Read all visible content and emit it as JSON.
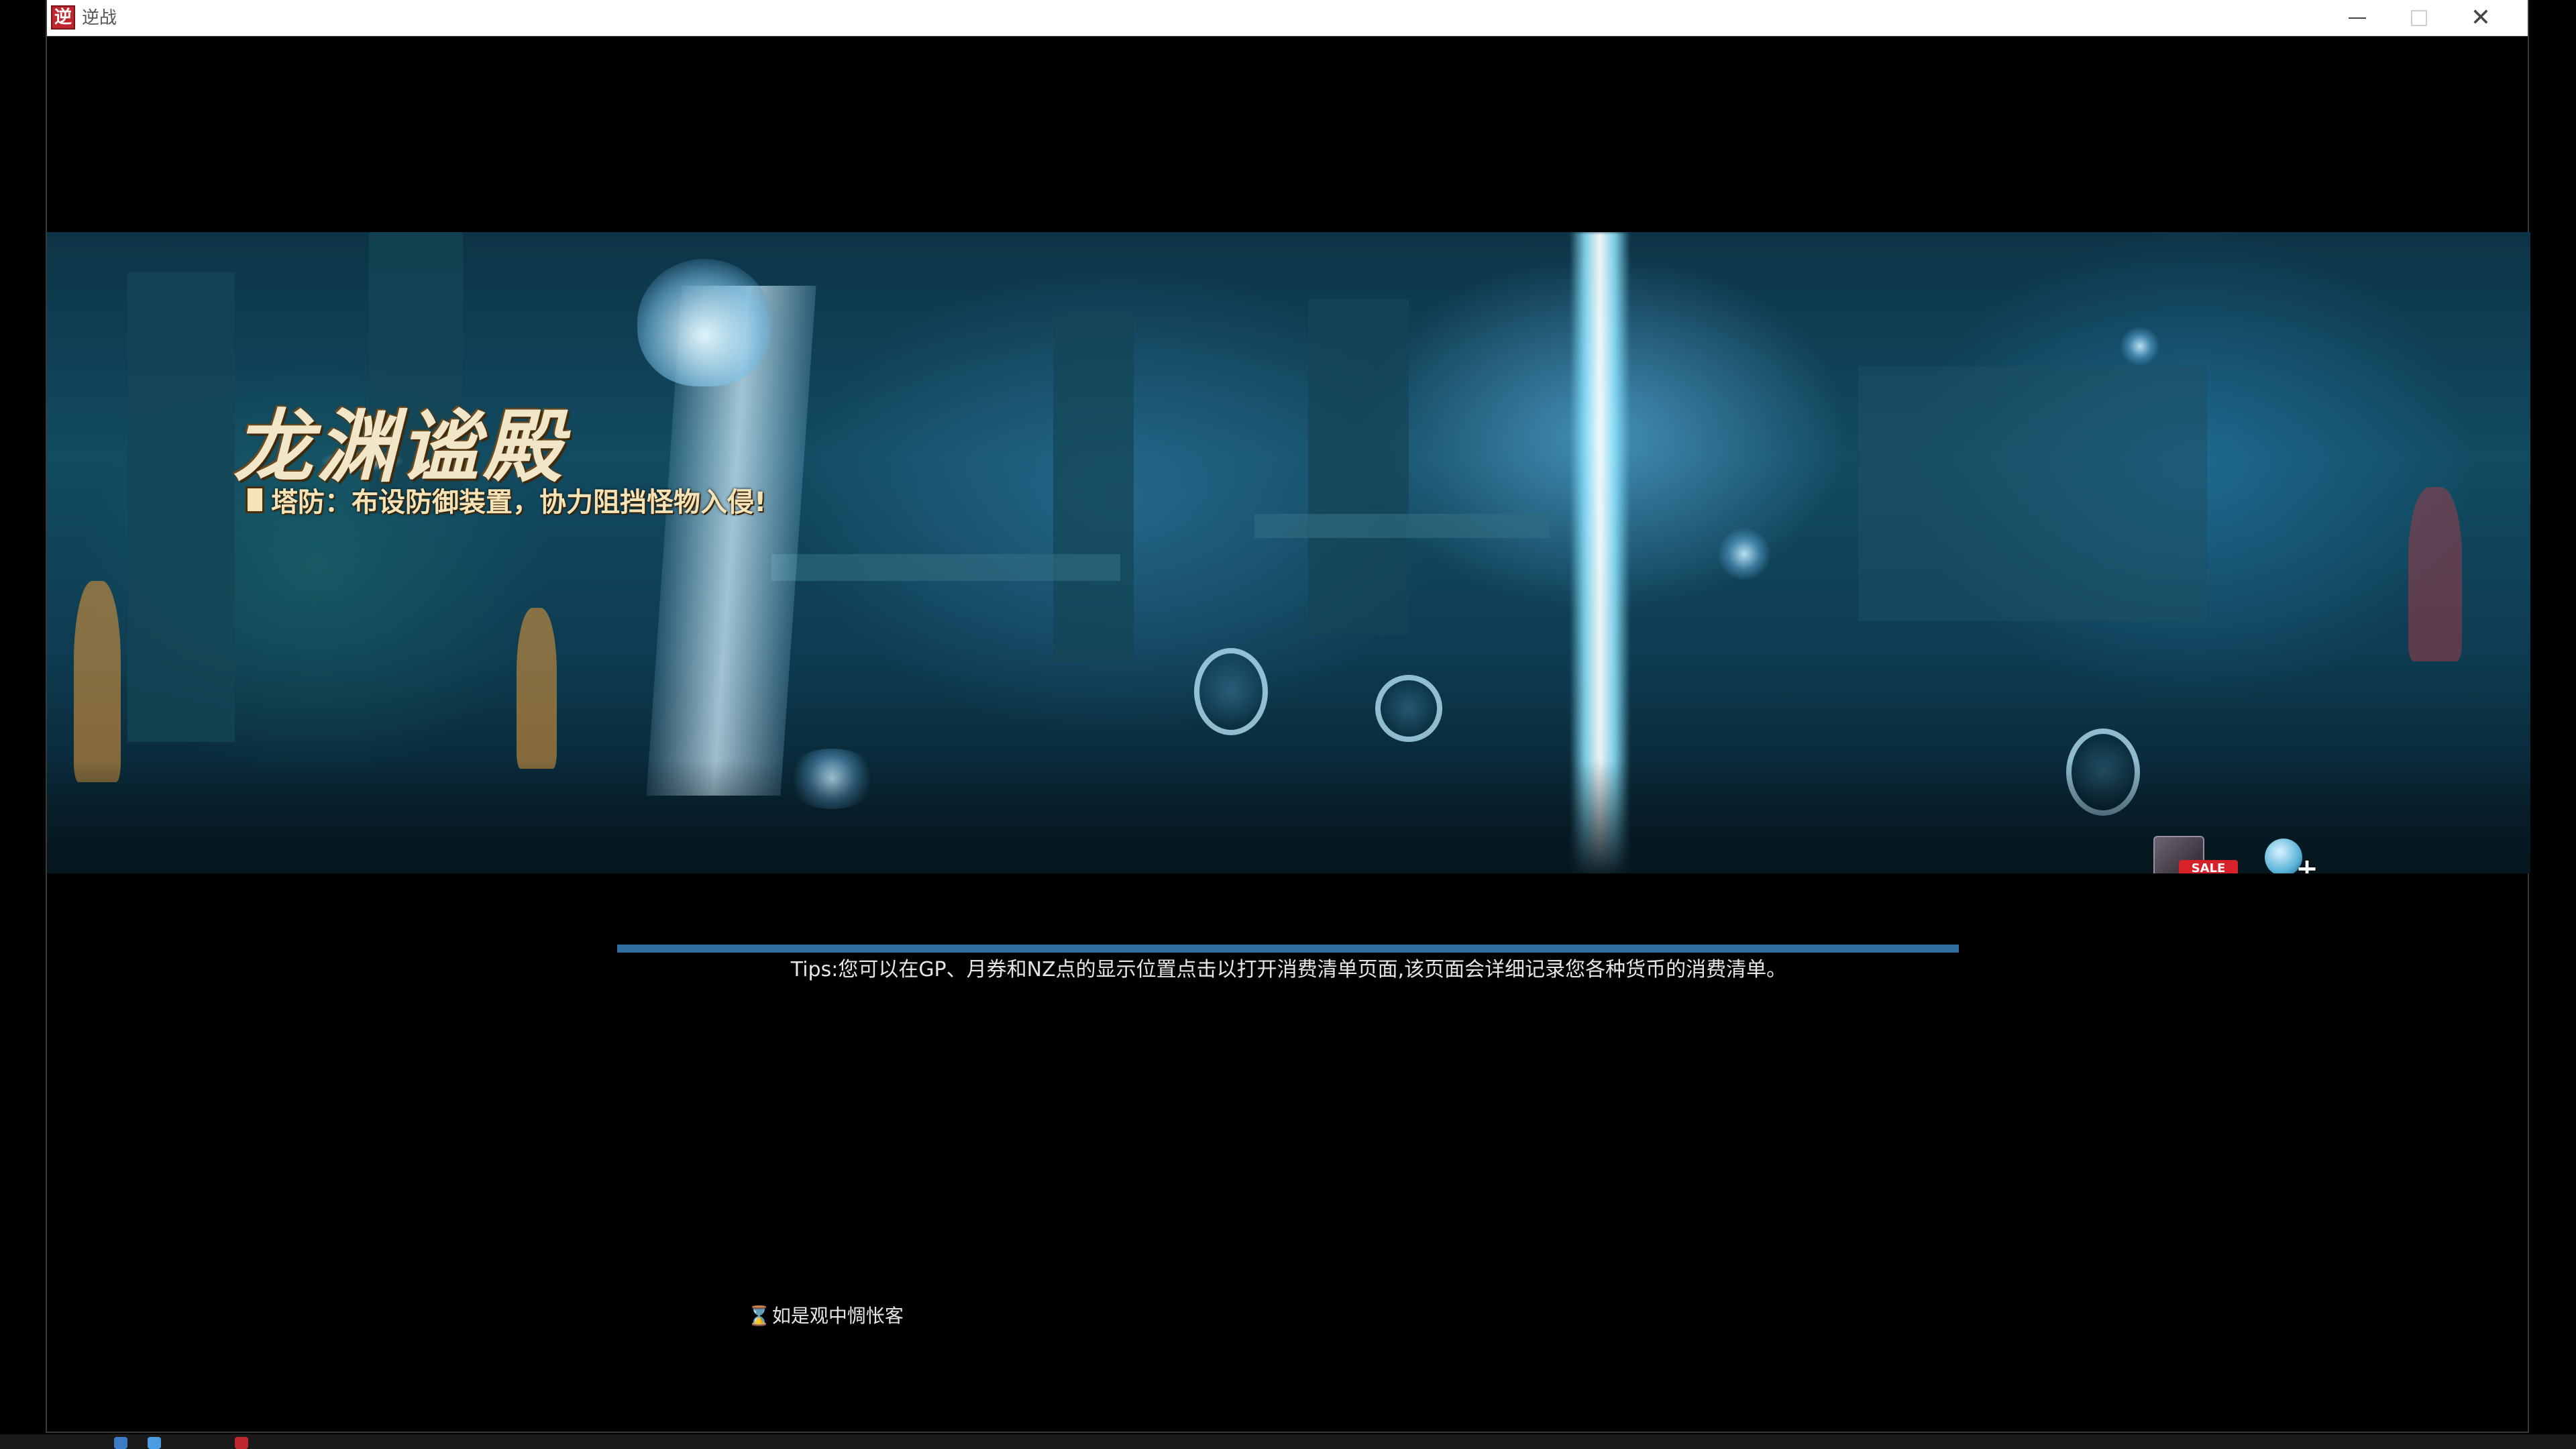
{
  "window": {
    "app_icon_glyph": "逆",
    "title": "逆战",
    "minimize_label": "–",
    "close_label": "✕"
  },
  "banner": {
    "title": "龙渊谧殿",
    "subtitle": "塔防：布设防御装置，协力阻挡怪物入侵!",
    "sale_label": "SALE",
    "icons": [
      "sale-shop-icon",
      "add-friend-icon"
    ]
  },
  "loading": {
    "progress": 1.0,
    "tips": "Tips:您可以在GP、月券和NZ点的显示位置点击以打开消费清单页面,该页面会详细记录您各种货币的消费清单。",
    "status_icon": "hourglass-icon",
    "status_text": "如是观中惆怅客"
  },
  "colors": {
    "progress_fill": "#2e6f9e",
    "progress_track": "#6d6d6d",
    "title_bar": "#ffffff",
    "background": "#000000",
    "sale_tag": "#d8222a"
  }
}
